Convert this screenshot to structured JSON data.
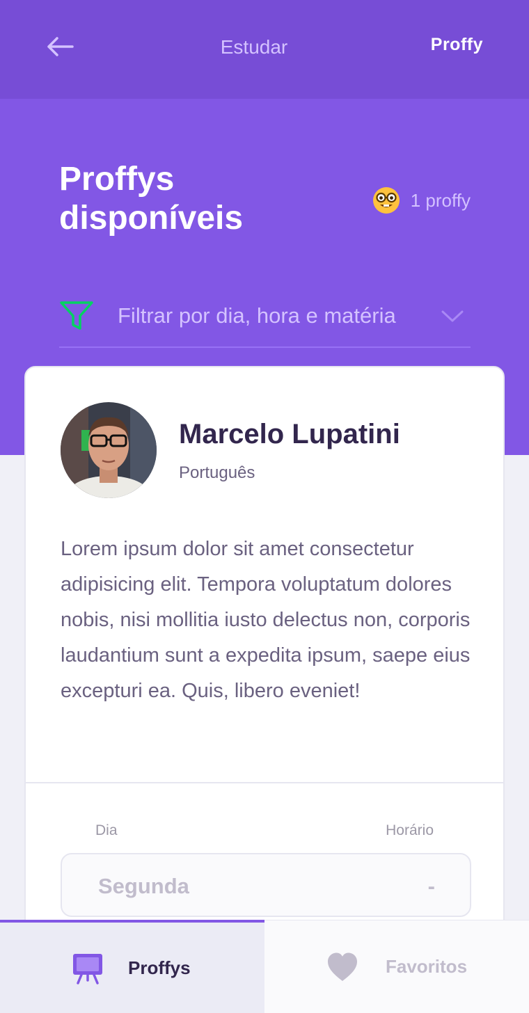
{
  "header": {
    "title": "Estudar",
    "brand": "Proffy"
  },
  "hero": {
    "title": "Proffys disponíveis",
    "count_label": "1 proffy",
    "filter_label": "Filtrar por dia, hora e matéria"
  },
  "teacher": {
    "name": "Marcelo Lupatini",
    "subject": "Português",
    "bio": "Lorem ipsum dolor sit amet consectetur adipisicing elit. Tempora voluptatum dolores nobis, nisi mollitia iusto delectus non, corporis laudantium sunt a expedita ipsum, saepe eius excepturi ea. Quis, libero eveniet!",
    "schedule": {
      "day_label": "Dia",
      "hour_label": "Horário",
      "day": "Segunda",
      "hour": "-"
    }
  },
  "tabs": [
    {
      "label": "Proffys",
      "icon": "easel-icon",
      "active": true
    },
    {
      "label": "Favoritos",
      "icon": "heart-icon",
      "active": false
    }
  ],
  "colors": {
    "primary": "#8257E5",
    "primary_dark": "#774DD6",
    "primary_light": "#D4C2FF",
    "filter_icon": "#04D361",
    "title_dark": "#32264D",
    "text_base": "#6A6180",
    "text_muted": "#C1BCCC"
  }
}
